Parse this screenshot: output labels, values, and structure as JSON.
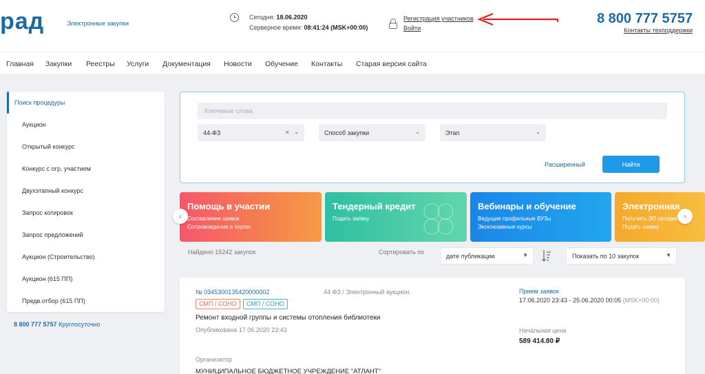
{
  "header": {
    "logo": "рад",
    "logo_sub": "Электронные закупки",
    "today_label": "Сегодня: ",
    "today_value": "18.06.2020",
    "server_label": "Серверное время: ",
    "server_value": "08:41:24 (MSK+00:00)",
    "register_link": "Регистрация участников",
    "login_link": "Войти",
    "phone": "8 800 777 5757",
    "support_link": "Контакты техподдержки",
    "annotation_arrow_color": "#e0201a"
  },
  "nav": {
    "items": [
      {
        "label": "Главная"
      },
      {
        "label": "Закупки"
      },
      {
        "label": "Реестры"
      },
      {
        "label": "Услуги"
      },
      {
        "label": "Документация"
      },
      {
        "label": "Новости"
      },
      {
        "label": "Обучение"
      },
      {
        "label": "Контакты"
      },
      {
        "label": "Старая версия сайта"
      }
    ]
  },
  "sidebar": {
    "items": [
      {
        "label": "Поиск процедуры",
        "active": true
      },
      {
        "label": "Аукцион"
      },
      {
        "label": "Открытый конкурс"
      },
      {
        "label": "Конкурс с огр. участием"
      },
      {
        "label": "Двухэтапный конкурс"
      },
      {
        "label": "Запрос котировок"
      },
      {
        "label": "Запрос предложений"
      },
      {
        "label": "Аукцион (Строительство)"
      },
      {
        "label": "Аукцион (615 ПП)"
      },
      {
        "label": "Предв.отбор (615 ПП)"
      }
    ],
    "phone": "8 800 777 5757",
    "phone_note": " Круглосуточно"
  },
  "search": {
    "keywords_placeholder": "Ключевые слова",
    "law_value": "44-ФЗ",
    "law_clear": "×",
    "method_value": "Способ закупки",
    "stage_value": "Этап",
    "advanced_link": "Расширенный",
    "find_button": "Найти"
  },
  "banners": [
    {
      "title": "Помощь в участии",
      "line1": "Составление заявок",
      "line2": "Сопровождение в торгах"
    },
    {
      "title": "Тендерный кредит",
      "line1": "Подать заявку",
      "line2": ""
    },
    {
      "title": "Вебинары и обучение",
      "line1": "Ведущие профильные ВУЗы",
      "line2": "Эксклюзивные курсы"
    },
    {
      "title": "Электронная",
      "line1": "Получить ЭП сегодня",
      "line2": "Подать заявку"
    }
  ],
  "results": {
    "found": "Найдено 15242 закупок",
    "sort_label": "Сортировать по",
    "sort_value": "дате публикации",
    "count_value": "Показать по 10 закупок"
  },
  "card": {
    "number": "№ 0345300135420000002",
    "type": "44 ФЗ / Электронный аукцион",
    "tag1": "СМП / СОНО",
    "tag2": "СМП / СОНО",
    "title": "Ремонт входной группы и системы отопления библиотеки",
    "published": "Опубликована 17.06.2020 23:43",
    "org_label": "Организатор",
    "org": "МУНИЦИПАЛЬНОЕ БЮДЖЕТНОЕ УЧРЕЖДЕНИЕ \"АТЛАНТ\"",
    "recv_label": "Прием заявок",
    "recv_dates": "17.06.2020 23:43 - 25.06.2020 00:05 ",
    "recv_tz": "(MSK+00:00)",
    "price_label": "Начальная цена",
    "price": "589 414.80 ₽"
  },
  "colors": {
    "brand": "#1b6aa6",
    "button": "#1e9be8"
  }
}
